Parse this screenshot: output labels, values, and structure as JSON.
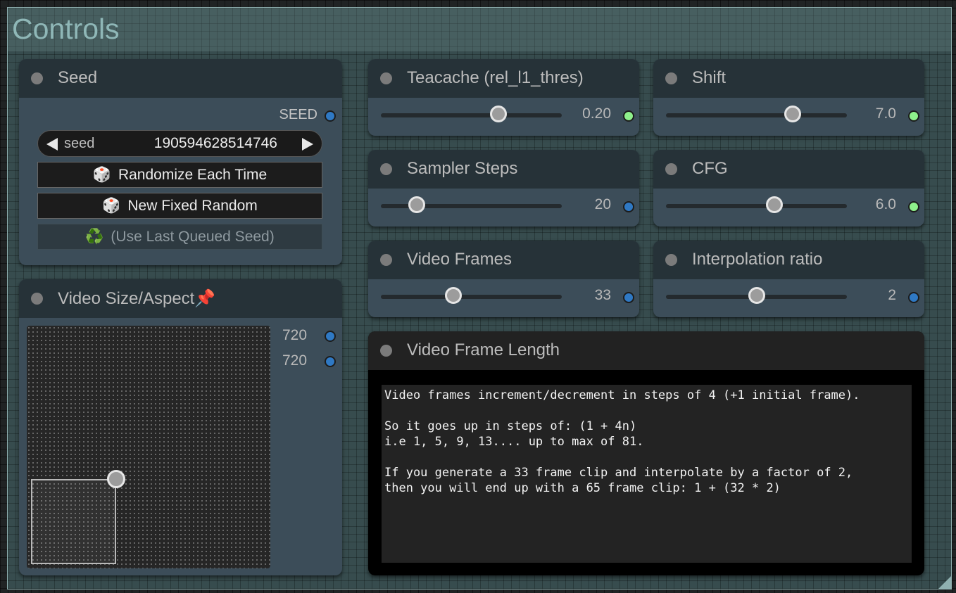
{
  "group": {
    "title": "Controls"
  },
  "seed_node": {
    "title": "Seed",
    "output_label": "SEED",
    "widget_name": "seed",
    "value": "190594628514746",
    "buttons": {
      "randomize": {
        "icon": "🎲",
        "label": "Randomize Each Time"
      },
      "fixed": {
        "icon": "🎲",
        "label": "New Fixed Random"
      },
      "last": {
        "icon": "♻️",
        "label": "(Use Last Queued Seed)",
        "disabled": true
      }
    }
  },
  "size_node": {
    "title": "Video Size/Aspect📌",
    "width": "720",
    "height": "720"
  },
  "sliders": {
    "teacache": {
      "title": "Teacache (rel_l1_thres)",
      "value": "0.20",
      "fill": 0.65,
      "socket_color": "#8ef08b"
    },
    "shift": {
      "title": "Shift",
      "value": "7.0",
      "fill": 0.7,
      "socket_color": "#8ef08b"
    },
    "sampler_steps": {
      "title": "Sampler Steps",
      "value": "20",
      "fill": 0.2,
      "socket_color": "#2f79c4"
    },
    "cfg": {
      "title": "CFG",
      "value": "6.0",
      "fill": 0.6,
      "socket_color": "#8ef08b"
    },
    "video_frames": {
      "title": "Video Frames",
      "value": "33",
      "fill": 0.4,
      "socket_color": "#2f79c4"
    },
    "interpolation": {
      "title": "Interpolation ratio",
      "value": "2",
      "fill": 0.5,
      "socket_color": "#2f79c4"
    }
  },
  "note_node": {
    "title": "Video Frame Length",
    "text": "Video frames increment/decrement in steps of 4 (+1 initial frame).\n\nSo it goes up in steps of: (1 + 4n)\ni.e 1, 5, 9, 13.... up to max of 81.\n\nIf you generate a 33 frame clip and interpolate by a factor of 2,\nthen you will end up with a 65 frame clip: 1 + (32 * 2)"
  },
  "colors": {
    "group_title": "#8fb7b7",
    "socket_int": "#2f79c4",
    "socket_float": "#8ef08b"
  }
}
